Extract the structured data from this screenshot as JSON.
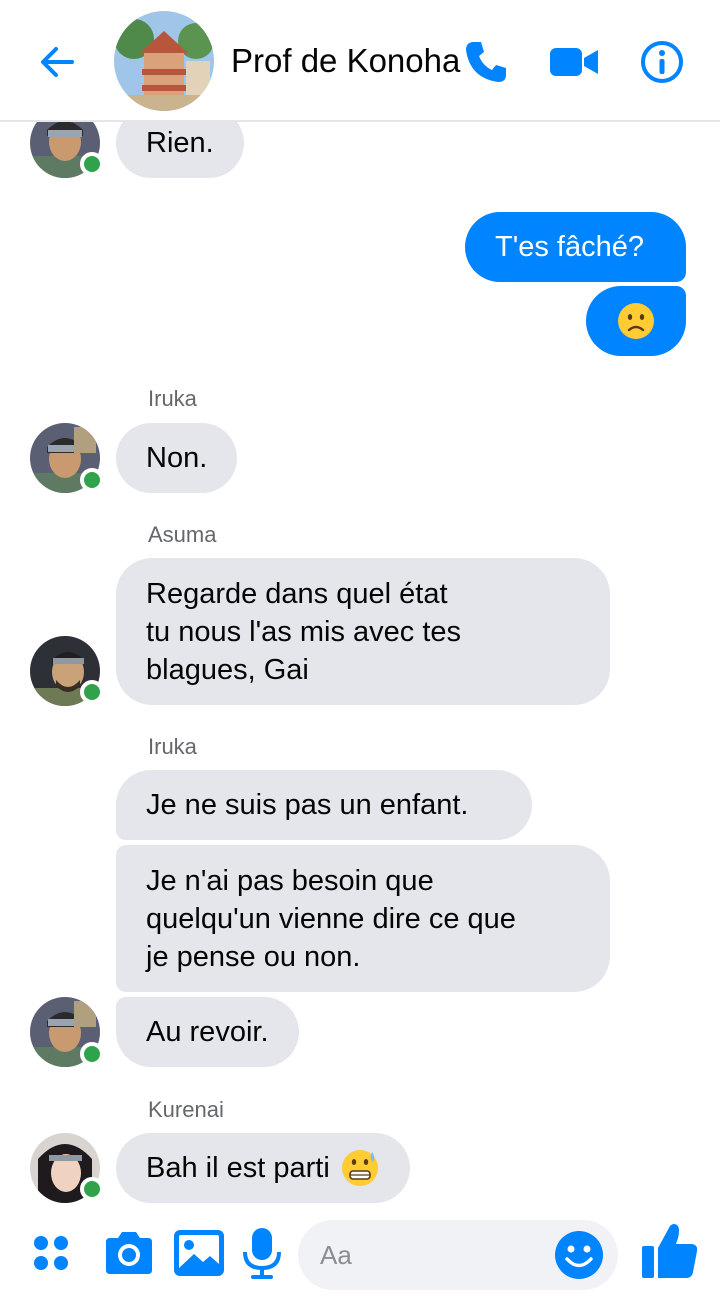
{
  "header": {
    "title": "Prof de Konoha"
  },
  "messages": {
    "m1": "Rien.",
    "m2": "T'es fâché?",
    "sender_iruka_1": "Iruka",
    "m4": "Non.",
    "sender_asuma": "Asuma",
    "m5": [
      "Regarde dans quel état",
      "tu nous l'as mis avec tes",
      "blagues, Gai"
    ],
    "sender_iruka_2": "Iruka",
    "m6": "Je ne suis pas un enfant.",
    "m7": [
      "Je n'ai pas besoin que",
      "quelqu'un vienne dire ce que",
      "je pense ou non."
    ],
    "m8": "Au revoir.",
    "sender_kurenai": "Kurenai",
    "m9": "Bah il est parti"
  },
  "composer": {
    "placeholder": "Aa"
  },
  "colors": {
    "accent": "#0084ff",
    "incoming_bubble": "#e4e6eb",
    "online": "#31a24c"
  },
  "icons": [
    "back-arrow-icon",
    "phone-icon",
    "video-icon",
    "info-icon",
    "apps-icon",
    "camera-icon",
    "gallery-icon",
    "microphone-icon",
    "smiley-icon",
    "thumbs-up-icon",
    "frowning-emoji",
    "grimacing-emoji"
  ]
}
